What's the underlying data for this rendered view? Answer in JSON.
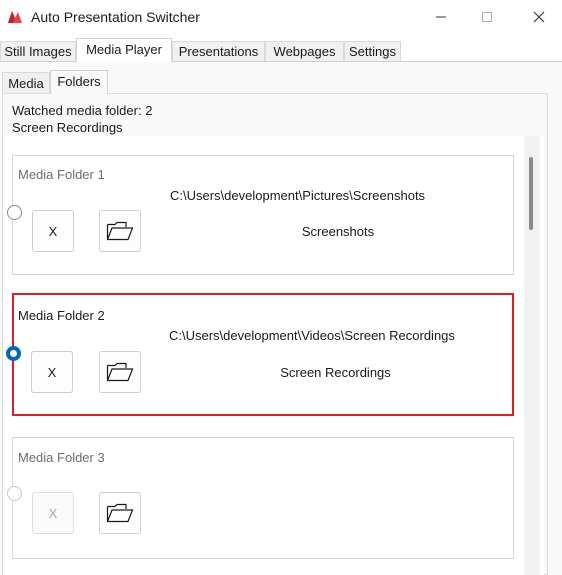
{
  "window": {
    "title": "Auto Presentation Switcher",
    "minimize_label": "—",
    "maximize_label": "☐",
    "close_label": "✕"
  },
  "tabs": [
    {
      "label": "Still Images",
      "active": false
    },
    {
      "label": "Media Player",
      "active": true
    },
    {
      "label": "Presentations",
      "active": false
    },
    {
      "label": "Webpages",
      "active": false
    },
    {
      "label": "Settings",
      "active": false
    }
  ],
  "subtabs": [
    {
      "label": "Media",
      "active": false
    },
    {
      "label": "Folders",
      "active": true
    }
  ],
  "watched": {
    "label": "Watched media folder: 2 Screen Recordings"
  },
  "folders": [
    {
      "title": "Media Folder 1",
      "path": "C:\\Users\\development\\Pictures\\Screenshots",
      "name": "Screenshots",
      "selected": false,
      "enabled": true,
      "clear_label": "X",
      "browse_icon": "folder-icon"
    },
    {
      "title": "Media Folder 2",
      "path": "C:\\Users\\development\\Videos\\Screen Recordings",
      "name": "Screen Recordings",
      "selected": true,
      "enabled": true,
      "clear_label": "X",
      "browse_icon": "folder-icon"
    },
    {
      "title": "Media Folder 3",
      "path": "",
      "name": "",
      "selected": false,
      "enabled": false,
      "clear_label": "X",
      "browse_icon": "folder-icon"
    }
  ],
  "colors": {
    "selection_border": "#e01e26",
    "radio_checked": "#0067c0"
  }
}
